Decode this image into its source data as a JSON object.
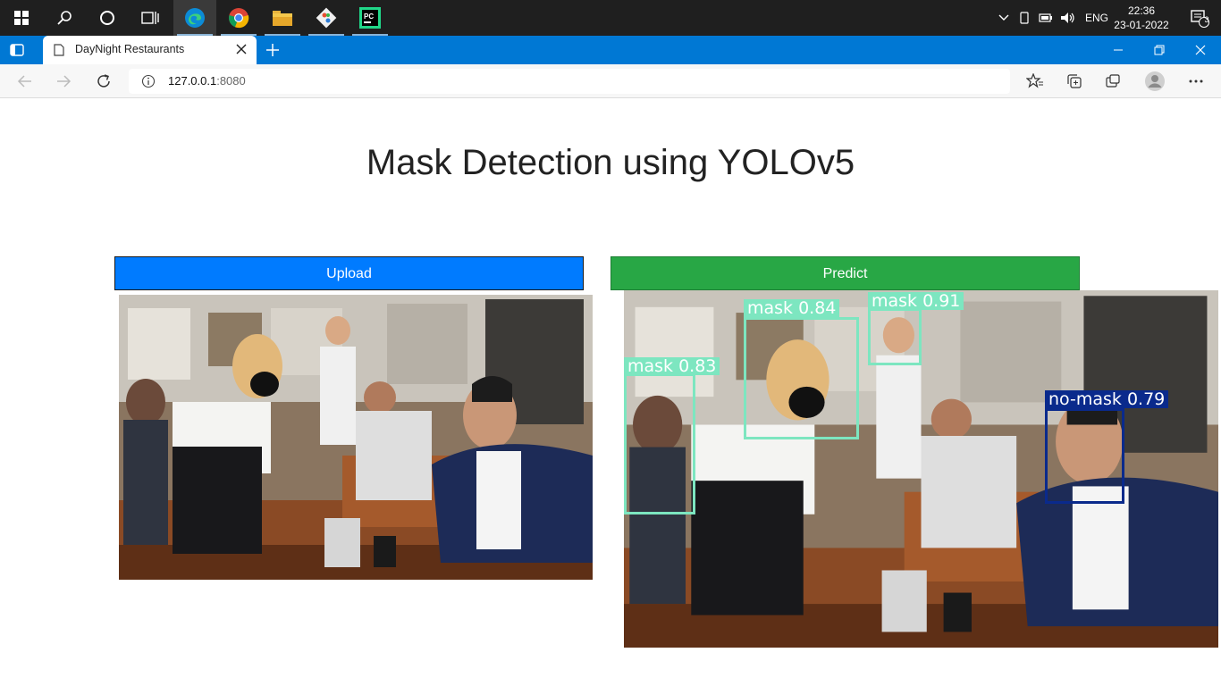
{
  "taskbar": {
    "language": "ENG",
    "time": "22:36",
    "date": "23-01-2022",
    "notification_count": "3",
    "apps": [
      "start",
      "search",
      "cortana",
      "task-view",
      "edge",
      "chrome",
      "file-explorer",
      "git",
      "pycharm"
    ]
  },
  "browser": {
    "tab_title": "DayNight Restaurants",
    "url_host": "127.0.0.1",
    "url_port": ":8080"
  },
  "page": {
    "title": "Mask Detection using YOLOv5",
    "upload_label": "Upload",
    "predict_label": "Predict",
    "colors": {
      "upload": "#007bff",
      "predict": "#28a745",
      "mask_box": "#7de6c0",
      "no_mask_box": "#0a2a8c"
    }
  },
  "detections": [
    {
      "label": "mask 0.83",
      "class": "mask"
    },
    {
      "label": "mask 0.84",
      "class": "mask"
    },
    {
      "label": "mask 0.91",
      "class": "mask"
    },
    {
      "label": "no-mask 0.79",
      "class": "no-mask"
    }
  ]
}
